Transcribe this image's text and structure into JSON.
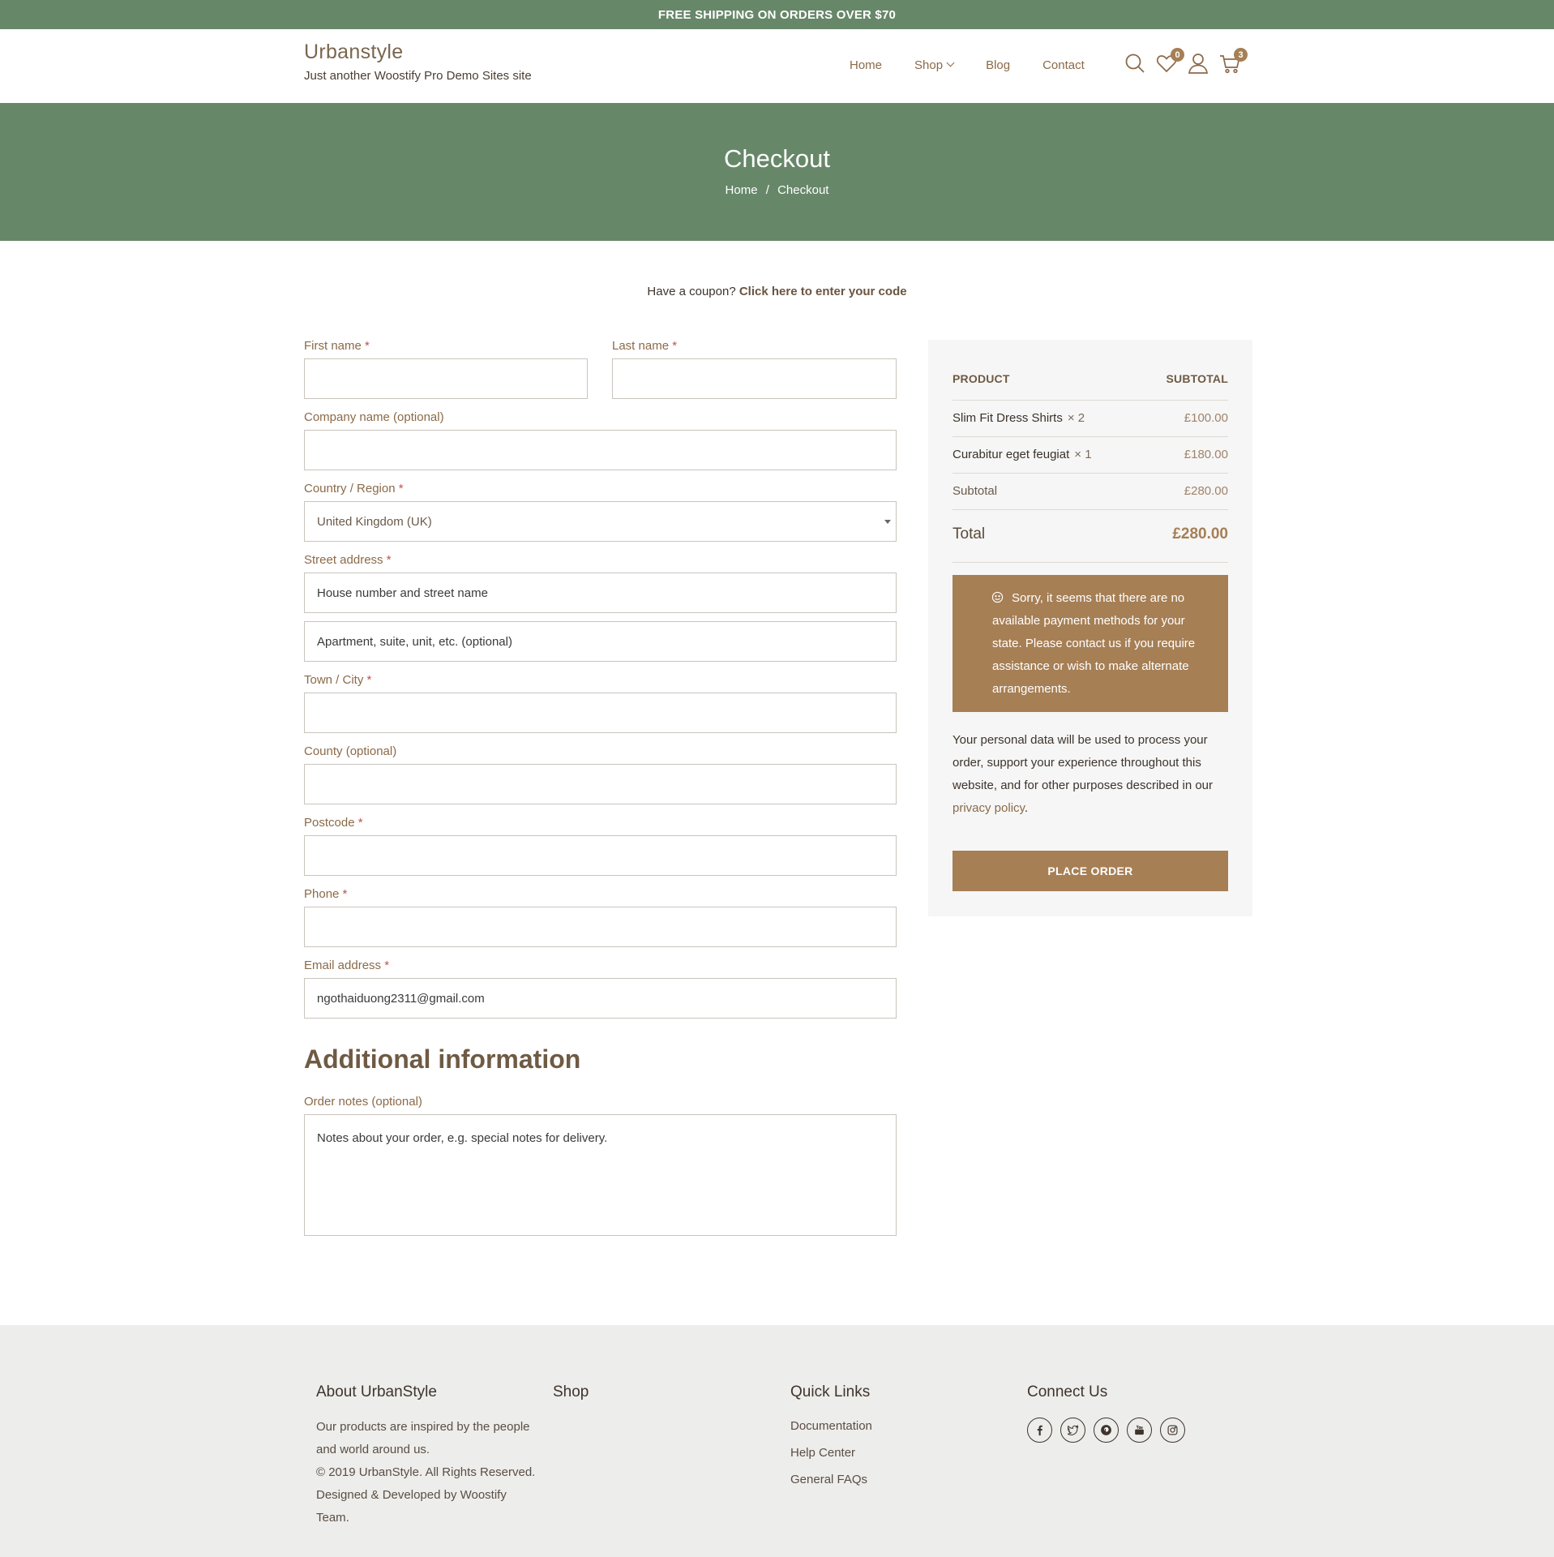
{
  "topbar": {
    "text": "FREE SHIPPING ON ORDERS OVER $70"
  },
  "header": {
    "brand": "Urbanstyle",
    "tagline": "Just another Woostify Pro Demo Sites site",
    "nav": [
      "Home",
      "Shop",
      "Blog",
      "Contact"
    ],
    "wishlist_count": "0",
    "cart_count": "3"
  },
  "hero": {
    "title": "Checkout",
    "crumb_home": "Home",
    "crumb_sep": "/",
    "crumb_current": "Checkout"
  },
  "coupon": {
    "text": "Have a coupon?",
    "link": "Click here to enter your code"
  },
  "form": {
    "first_name": "First name",
    "last_name": "Last name",
    "company": "Company name (optional)",
    "country": "Country / Region",
    "country_value": "United Kingdom (UK)",
    "street": "Street address",
    "street_placeholder": "House number and street name",
    "street2_placeholder": "Apartment, suite, unit, etc. (optional)",
    "town": "Town / City",
    "county": "County (optional)",
    "postcode": "Postcode",
    "phone": "Phone",
    "email": "Email address",
    "email_value": "ngothaiduong2311@gmail.com",
    "required": "*",
    "additional_title": "Additional information",
    "notes_label": "Order notes (optional)",
    "notes_placeholder": "Notes about your order, e.g. special notes for delivery."
  },
  "summary": {
    "col_product": "PRODUCT",
    "col_subtotal": "SUBTOTAL",
    "items": [
      {
        "name": "Slim Fit Dress Shirts",
        "qty": "× 2",
        "price": "£100.00"
      },
      {
        "name": "Curabitur eget feugiat",
        "qty": "× 1",
        "price": "£180.00"
      }
    ],
    "subtotal_label": "Subtotal",
    "subtotal_value": "£280.00",
    "total_label": "Total",
    "total_value": "£280.00",
    "notice": "Sorry, it seems that there are no available payment methods for your state. Please contact us if you require assistance or wish to make alternate arrangements.",
    "privacy_text": "Your personal data will be used to process your order, support your experience throughout this website, and for other purposes described in our",
    "privacy_link": "privacy policy",
    "privacy_end": ".",
    "place_order": "PLACE ORDER"
  },
  "footer": {
    "about_title": "About UrbanStyle",
    "about_text": "Our products are inspired by the people and world around us.",
    "copyright": "© 2019 UrbanStyle. All Rights Reserved. Designed & Developed by Woostify Team.",
    "shop_title": "Shop",
    "links_title": "Quick Links",
    "links": [
      "Documentation",
      "Help Center",
      "General FAQs"
    ],
    "connect_title": "Connect Us",
    "socials": [
      "facebook-icon",
      "twitter-icon",
      "pinterest-icon",
      "youtube-icon",
      "instagram-icon"
    ]
  },
  "colors": {
    "green": "#678769",
    "brown": "#a67f55",
    "footer_bg": "#ededeb"
  }
}
